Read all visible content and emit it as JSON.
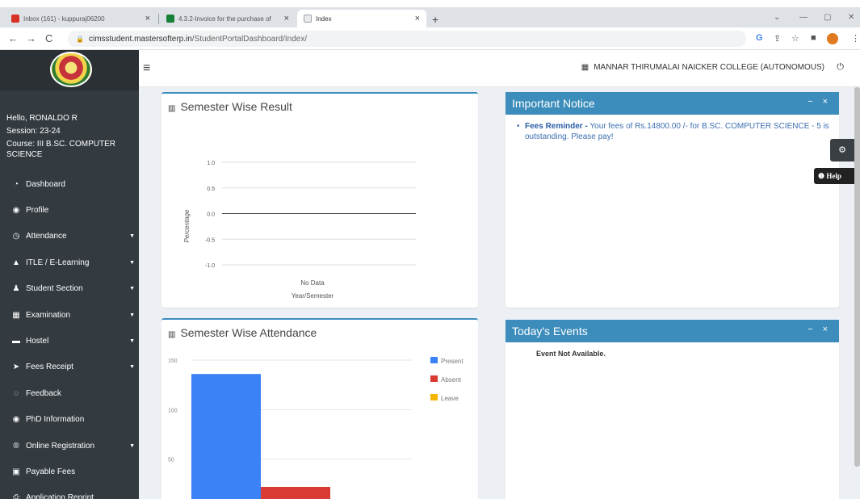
{
  "browser": {
    "tabs": [
      {
        "title": "Inbox (161) - kuppuraj06200",
        "favicon_color": "#d93025"
      },
      {
        "title": "4.3.2-Invoice for the purchase of",
        "favicon_color": "#188038"
      },
      {
        "title": "Index",
        "favicon_color": "#9aa0a6"
      }
    ],
    "url_host": "cimsstudent.mastersofterp.in",
    "url_path": "/StudentPortalDashboard/Index/"
  },
  "header": {
    "college": "MANNAR THIRUMALAI NAICKER COLLEGE (AUTONOMOUS)"
  },
  "user": {
    "greeting": "Hello, RONALDO R",
    "session": "Session: 23-24",
    "course": "Course: III B.SC. COMPUTER SCIENCE"
  },
  "menu": [
    {
      "label": "Dashboard",
      "icon": "tachometer-icon",
      "glyph": "◔",
      "has_sub": false
    },
    {
      "label": "Profile",
      "icon": "user-circle-icon",
      "glyph": "◉",
      "has_sub": false
    },
    {
      "label": "Attendance",
      "icon": "clock-icon",
      "glyph": "◷",
      "has_sub": true
    },
    {
      "label": "ITLE / E-Learning",
      "icon": "graduation-cap-icon",
      "glyph": "▲",
      "has_sub": true
    },
    {
      "label": "Student Section",
      "icon": "user-icon",
      "glyph": "♟",
      "has_sub": true
    },
    {
      "label": "Examination",
      "icon": "bank-icon",
      "glyph": "▦",
      "has_sub": true
    },
    {
      "label": "Hostel",
      "icon": "bed-icon",
      "glyph": "▬",
      "has_sub": true
    },
    {
      "label": "Fees Receipt",
      "icon": "paper-plane-icon",
      "glyph": "➤",
      "has_sub": true
    },
    {
      "label": "Feedback",
      "icon": "comment-icon",
      "glyph": "◌",
      "has_sub": false
    },
    {
      "label": "PhD Information",
      "icon": "user-circle-icon",
      "glyph": "◉",
      "has_sub": false
    },
    {
      "label": "Online Registration",
      "icon": "registered-icon",
      "glyph": "®",
      "has_sub": true
    },
    {
      "label": "Payable Fees",
      "icon": "money-icon",
      "glyph": "▣",
      "has_sub": false
    },
    {
      "label": "Application Reprint",
      "icon": "print-icon",
      "glyph": "⎙",
      "has_sub": false
    }
  ],
  "result_card": {
    "title": "Semester Wise Result"
  },
  "attendance_card": {
    "title": "Semester Wise Attendance"
  },
  "notice_card": {
    "title": "Important Notice",
    "label": "Fees Reminder -",
    "text": " Your fees of Rs.14800.00 /- for B.SC. COMPUTER SCIENCE - 5 is outstanding. Please pay!"
  },
  "events_card": {
    "title": "Today's Events",
    "text": "Event Not Available."
  },
  "help_label": "Help",
  "chart_data": [
    {
      "type": "line",
      "title": "",
      "xlabel": "Year/Semester",
      "ylabel": "Percentage",
      "y_ticks": [
        "1.0",
        "0.5",
        "0.0",
        "-0.5",
        "-1.0"
      ],
      "ylim": [
        -1.0,
        1.0
      ],
      "categories": [],
      "empty_label": "No Data",
      "grid": true
    },
    {
      "type": "bar",
      "title": "",
      "categories": [
        ""
      ],
      "series": [
        {
          "name": "Present",
          "values": [
            136
          ],
          "color": "#3b82f6"
        },
        {
          "name": "Absent",
          "values": [
            22
          ],
          "color": "#d93a34"
        },
        {
          "name": "Leave",
          "values": [
            0
          ],
          "color": "#f4b400"
        }
      ],
      "y_ticks": [
        "150",
        "100",
        "50"
      ],
      "ylim": [
        0,
        160
      ],
      "legend": "right",
      "grid": true
    }
  ]
}
